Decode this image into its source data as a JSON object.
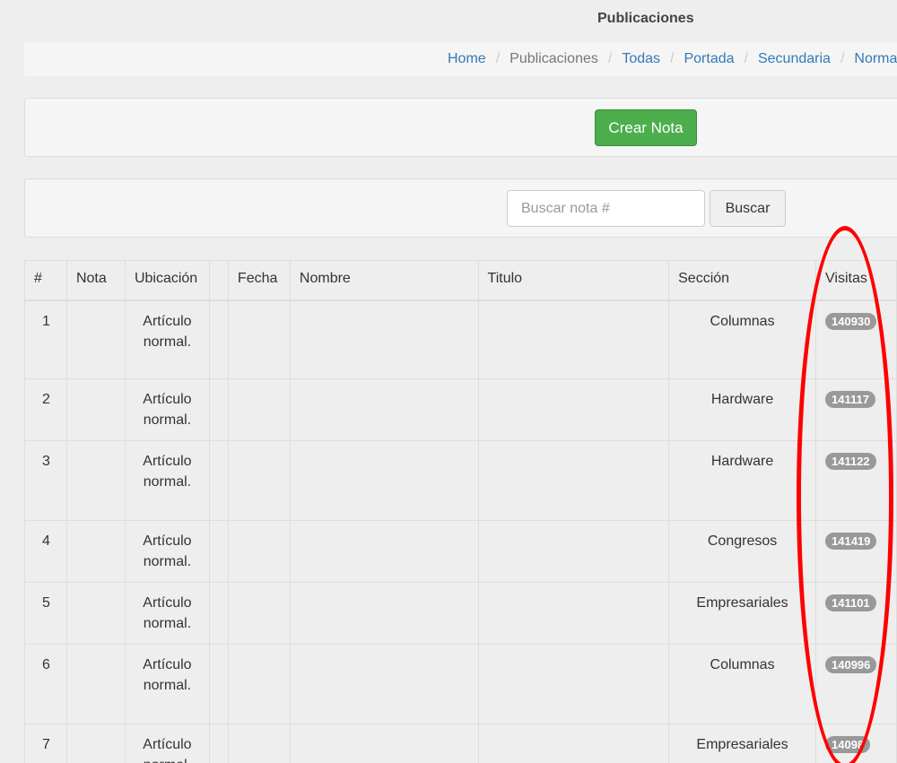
{
  "page": {
    "title": "Publicaciones"
  },
  "breadcrumb": [
    {
      "label": "Home",
      "active": false
    },
    {
      "label": "Publicaciones",
      "active": true
    },
    {
      "label": "Todas",
      "active": false
    },
    {
      "label": "Portada",
      "active": false
    },
    {
      "label": "Secundaria",
      "active": false
    },
    {
      "label": "Normal",
      "active": false
    }
  ],
  "toolbar": {
    "create_label": "Crear Nota"
  },
  "search": {
    "placeholder": "Buscar nota #",
    "button_label": "Buscar"
  },
  "table": {
    "columns": [
      "#",
      "Nota",
      "Ubicación",
      "",
      "Fecha",
      "Nombre",
      "Titulo",
      "Sección",
      "Visitas"
    ],
    "rows": [
      {
        "num": "1",
        "ubicacion": "Artículo normal.",
        "seccion": "Columnas",
        "visitas": "140930"
      },
      {
        "num": "2",
        "ubicacion": "Artículo normal.",
        "seccion": "Hardware",
        "visitas": "141117"
      },
      {
        "num": "3",
        "ubicacion": "Artículo normal.",
        "seccion": "Hardware",
        "visitas": "141122"
      },
      {
        "num": "4",
        "ubicacion": "Artículo normal.",
        "seccion": "Congresos",
        "visitas": "141419"
      },
      {
        "num": "5",
        "ubicacion": "Artículo normal.",
        "seccion": "Empresariales",
        "visitas": "141101"
      },
      {
        "num": "6",
        "ubicacion": "Artículo normal.",
        "seccion": "Columnas",
        "visitas": "140996"
      },
      {
        "num": "7",
        "ubicacion": "Artículo normal.",
        "seccion": "Empresariales",
        "visitas": "14098"
      }
    ]
  },
  "colors": {
    "accent_green": "#4cae4c",
    "link": "#337ab7",
    "annotation": "#ff0000",
    "badge": "#999999"
  }
}
